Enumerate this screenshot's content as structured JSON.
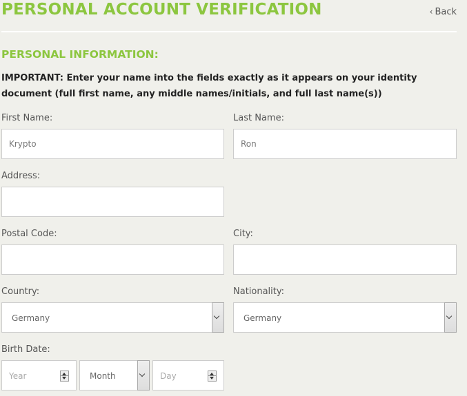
{
  "header": {
    "title": "PERSONAL ACCOUNT VERIFICATION",
    "back_label": "Back"
  },
  "section": {
    "title": "PERSONAL INFORMATION:",
    "important_note": "IMPORTANT: Enter your name into the fields exactly as it appears on your identity document (full first name, any middle names/initials, and full last name(s))"
  },
  "form": {
    "first_name": {
      "label": "First Name:",
      "value": "Krypto"
    },
    "last_name": {
      "label": "Last Name:",
      "value": "Ron"
    },
    "address": {
      "label": "Address:",
      "value": ""
    },
    "postal_code": {
      "label": "Postal Code:",
      "value": ""
    },
    "city": {
      "label": "City:",
      "value": ""
    },
    "country": {
      "label": "Country:",
      "selected": "Germany"
    },
    "nationality": {
      "label": "Nationality:",
      "selected": "Germany"
    },
    "birth_date": {
      "label": "Birth Date:",
      "year_placeholder": "Year",
      "month_selected": "Month",
      "day_placeholder": "Day"
    }
  },
  "icons": {
    "back": "chevron-left-icon",
    "select": "chevron-down-icon",
    "spinner": "spinner-arrows-icon"
  },
  "colors": {
    "accent": "#8cc63f",
    "background": "#f0f0eb"
  }
}
